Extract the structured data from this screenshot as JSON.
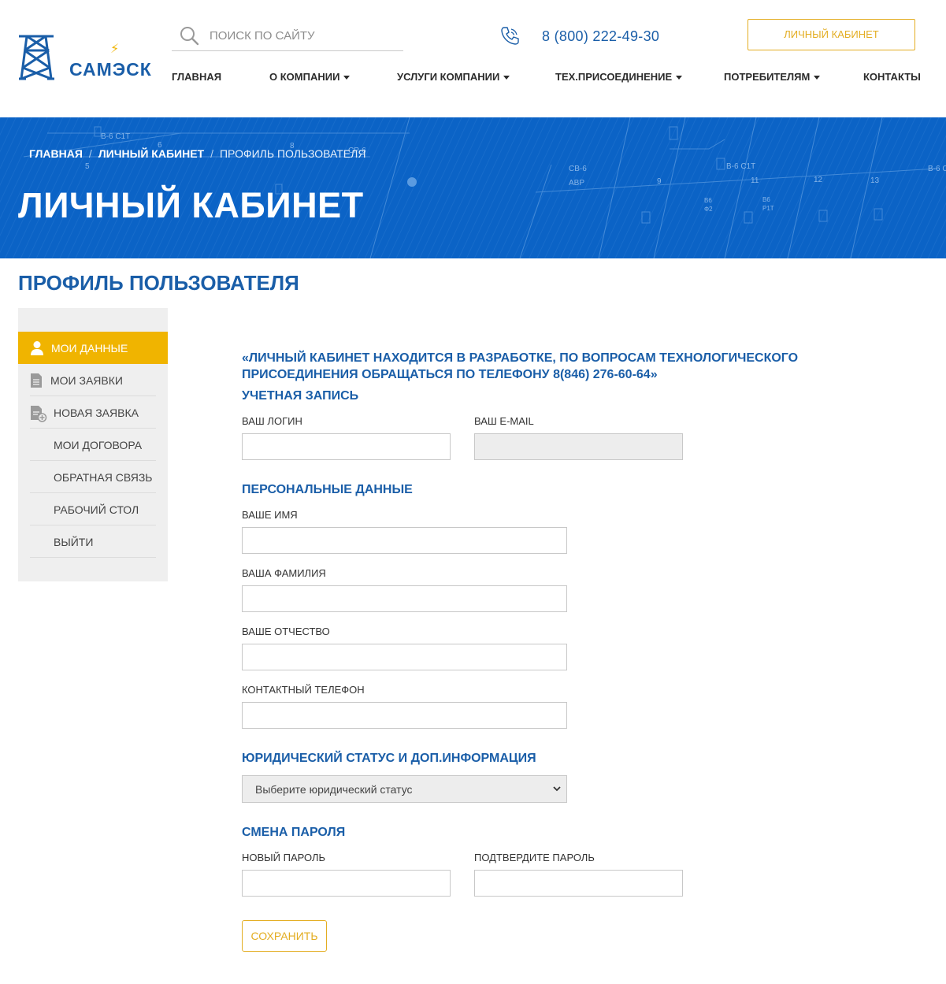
{
  "header": {
    "logo_text": "САМЭСК",
    "search_placeholder": "ПОИСК ПО САЙТУ",
    "phone": "8 (800) 222-49-30",
    "cabinet_button": "ЛИЧНЫЙ КАБИНЕТ",
    "nav": [
      {
        "label": "ГЛАВНАЯ"
      },
      {
        "label": "О КОМПАНИИ"
      },
      {
        "label": "УСЛУГИ КОМПАНИИ"
      },
      {
        "label": "ТЕХ.ПРИСОЕДИНЕНИЕ"
      },
      {
        "label": "ПОТРЕБИТЕЛЯМ"
      },
      {
        "label": "КОНТАКТЫ"
      }
    ]
  },
  "banner": {
    "breadcrumb": {
      "home": "ГЛАВНАЯ",
      "cabinet": "ЛИЧНЫЙ КАБИНЕТ",
      "current": "ПРОФИЛЬ ПОЛЬЗОВАТЕЛЯ"
    },
    "title": "ЛИЧНЫЙ КАБИНЕТ"
  },
  "page_title": "ПРОФИЛЬ ПОЛЬЗОВАТЕЛЯ",
  "sidebar": {
    "items": [
      {
        "label": "МОИ ДАННЫЕ",
        "icon": "user-icon",
        "active": true
      },
      {
        "label": "МОИ ЗАЯВКИ",
        "icon": "document-icon"
      },
      {
        "label": "НОВАЯ ЗАЯВКА",
        "icon": "new-document-icon"
      },
      {
        "label": "МОИ ДОГОВОРА"
      },
      {
        "label": "ОБРАТНАЯ СВЯЗЬ"
      },
      {
        "label": "РАБОЧИЙ СТОЛ"
      },
      {
        "label": "ВЫЙТИ"
      }
    ]
  },
  "form": {
    "notice": "«ЛИЧНЫЙ КАБИНЕТ НАХОДИТСЯ В РАЗРАБОТКЕ, ПО ВОПРОСАМ ТЕХНОЛОГИЧЕСКОГО ПРИСОЕДИНЕНИЯ ОБРАЩАТЬСЯ ПО ТЕЛЕФОНУ 8(846) 276-60-64»",
    "account": {
      "heading": "УЧЕТНАЯ ЗАПИСЬ",
      "login_label": "ВАШ ЛОГИН",
      "login_value": "",
      "email_label": "ВАШ E-MAIL",
      "email_value": ""
    },
    "personal": {
      "heading": "ПЕРСОНАЛЬНЫЕ ДАННЫЕ",
      "first_name_label": "ВАШЕ ИМЯ",
      "first_name_value": "",
      "last_name_label": "ВАША ФАМИЛИЯ",
      "last_name_value": "",
      "patronymic_label": "ВАШЕ ОТЧЕСТВО",
      "patronymic_value": "",
      "phone_label": "КОНТАКТНЫЙ ТЕЛЕФОН",
      "phone_value": ""
    },
    "legal": {
      "heading": "ЮРИДИЧЕСКИЙ СТАТУС И ДОП.ИНФОРМАЦИЯ",
      "select_value": "Выберите юридический статус"
    },
    "password": {
      "heading": "СМЕНА ПАРОЛЯ",
      "new_label": "НОВЫЙ ПАРОЛЬ",
      "new_value": "",
      "confirm_label": "ПОДТВЕРДИТЕ ПАРОЛЬ",
      "confirm_value": ""
    },
    "save_button": "СОХРАНИТЬ"
  },
  "colors": {
    "brand_blue": "#1a5ea8",
    "banner_blue": "#0b63c6",
    "accent_yellow": "#f0b400"
  }
}
